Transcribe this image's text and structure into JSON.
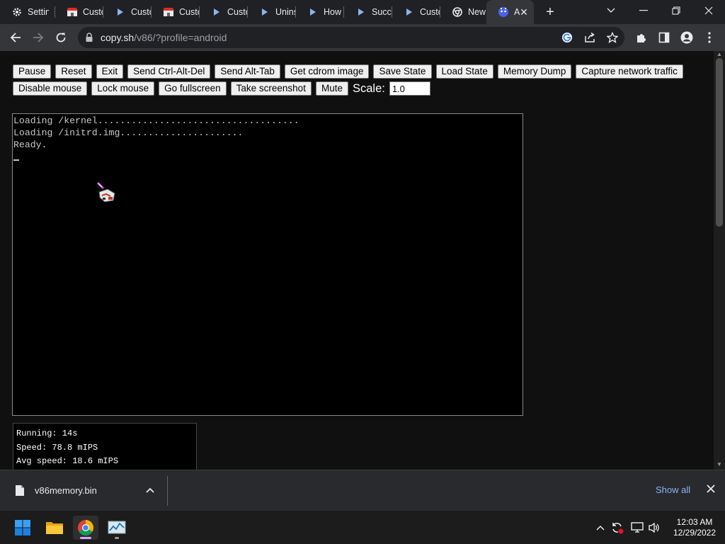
{
  "tabs": [
    {
      "label": "Settings",
      "icon": "gear-icon"
    },
    {
      "label": "Custom",
      "icon": "store-icon"
    },
    {
      "label": "Custom",
      "icon": "play-triangle-icon"
    },
    {
      "label": "Custom",
      "icon": "store-icon"
    },
    {
      "label": "Custom",
      "icon": "play-triangle-icon"
    },
    {
      "label": "Uninstall",
      "icon": "play-triangle-icon"
    },
    {
      "label": "How",
      "icon": "play-triangle-icon"
    },
    {
      "label": "Success",
      "icon": "play-triangle-icon"
    },
    {
      "label": "Custom",
      "icon": "play-triangle-icon"
    },
    {
      "label": "New",
      "icon": "chrome-icon"
    },
    {
      "label": "A",
      "icon": "v86-icon"
    }
  ],
  "address": {
    "host": "copy.sh",
    "path": "/v86/?profile=android"
  },
  "buttons_row1": [
    "Pause",
    "Reset",
    "Exit",
    "Send Ctrl-Alt-Del",
    "Send Alt-Tab",
    "Get cdrom image",
    "Save State",
    "Load State",
    "Memory Dump",
    "Capture network traffic"
  ],
  "buttons_row2": [
    "Disable mouse",
    "Lock mouse",
    "Go fullscreen",
    "Take screenshot",
    "Mute"
  ],
  "scale": {
    "label": "Scale:",
    "value": "1.0"
  },
  "terminal": {
    "lines": [
      "Loading /kernel....................................",
      "Loading /initrd.img......................",
      "Ready."
    ]
  },
  "stats": {
    "running": "Running: 14s",
    "speed": "Speed: 78.8 mIPS",
    "avg_speed": "Avg speed: 18.6 mIPS"
  },
  "download": {
    "filename": "v86memory.bin",
    "show_all": "Show all"
  },
  "clock": {
    "time": "12:03 AM",
    "date": "12/29/2022"
  }
}
